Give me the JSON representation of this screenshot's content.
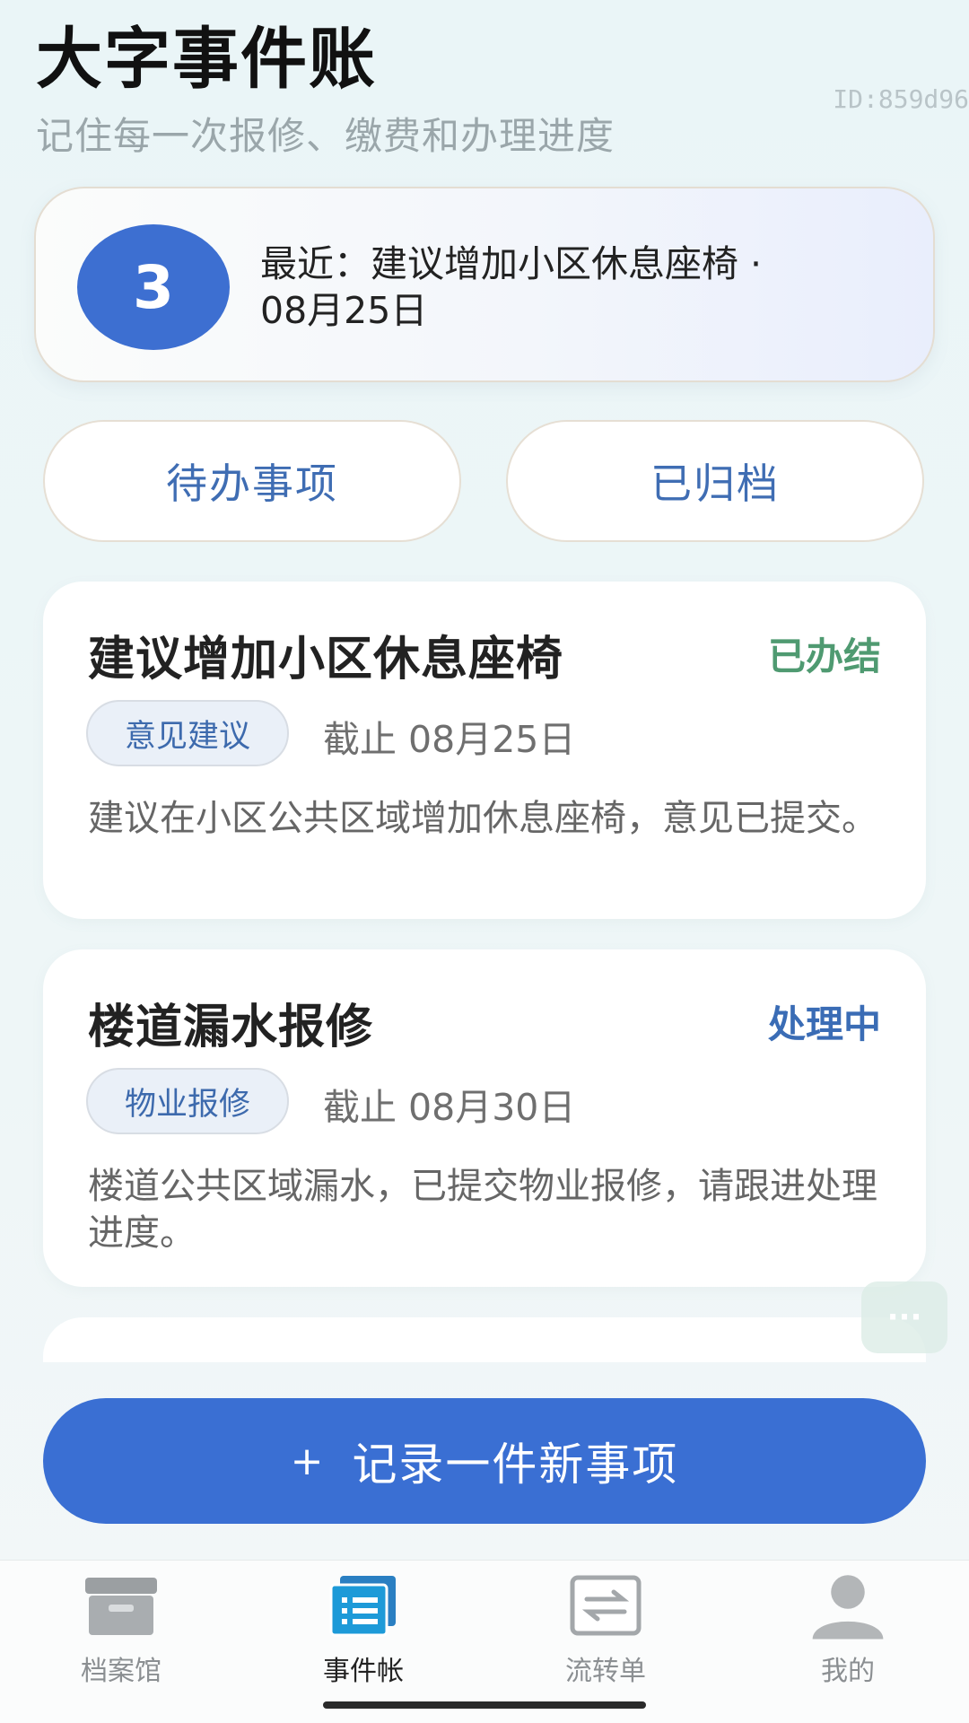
{
  "header": {
    "title": "大字事件账",
    "subtitle": "记住每一次报修、缴费和办理进度",
    "id_label": "ID:859d96"
  },
  "summary": {
    "count": "3",
    "recent_line1": "最近：建议增加小区休息座椅 ·",
    "recent_line2": "08月25日"
  },
  "tabs": [
    {
      "label": "待办事项"
    },
    {
      "label": "已归档"
    }
  ],
  "events": [
    {
      "title": "建议增加小区休息座椅",
      "status": "已办结",
      "status_color": "#4f9a71",
      "tag": "意见建议",
      "deadline": "截止 08月25日",
      "description": "建议在小区公共区域增加休息座椅，意见已提交。"
    },
    {
      "title": "楼道漏水报修",
      "status": "处理中",
      "status_color": "#3a6cb5",
      "tag": "物业报修",
      "deadline": "截止 08月30日",
      "description": "楼道公共区域漏水，已提交物业报修，请跟进处理进度。"
    }
  ],
  "add_button": {
    "icon": "+",
    "label": "记录一件新事项"
  },
  "bottom_nav": [
    {
      "label": "档案馆",
      "icon": "archive-box-icon",
      "active": false
    },
    {
      "label": "事件帐",
      "icon": "ledger-icon",
      "active": true
    },
    {
      "label": "流转单",
      "icon": "transfer-icon",
      "active": false
    },
    {
      "label": "我的",
      "icon": "person-icon",
      "active": false
    }
  ],
  "colors": {
    "accent": "#3a6fd3",
    "tab_text": "#3f6db3",
    "done": "#4f9a71",
    "processing": "#3a6cb5"
  }
}
